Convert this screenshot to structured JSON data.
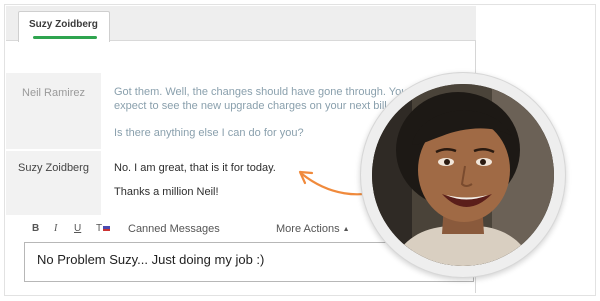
{
  "tab": {
    "label": "Suzy Zoidberg"
  },
  "messages": [
    {
      "sender": "Neil Ramirez",
      "lines": [
        "Got them. Well, the changes should have gone through. You",
        "expect to see the new upgrade charges on your next bill.",
        "Is there anything else I can do for you?"
      ]
    },
    {
      "sender": "Suzy Zoidberg",
      "lines": [
        "No. I am great, that is it for today.",
        "Thanks a million Neil!"
      ]
    }
  ],
  "toolbar": {
    "bold": "B",
    "italic": "I",
    "underline": "U",
    "text_color": "T",
    "canned_messages": "Canned Messages",
    "more_actions": "More Actions",
    "more_actions_caret": "▲"
  },
  "reply": {
    "value": "No Problem Suzy... Just doing my job :)"
  },
  "colors": {
    "accent_green": "#2ea44f",
    "arrow_orange": "#f08a3c",
    "agent_text": "#8aa0ad"
  },
  "icons": {
    "arrow": "curved-arrow-icon",
    "caret": "caret-up-icon"
  }
}
